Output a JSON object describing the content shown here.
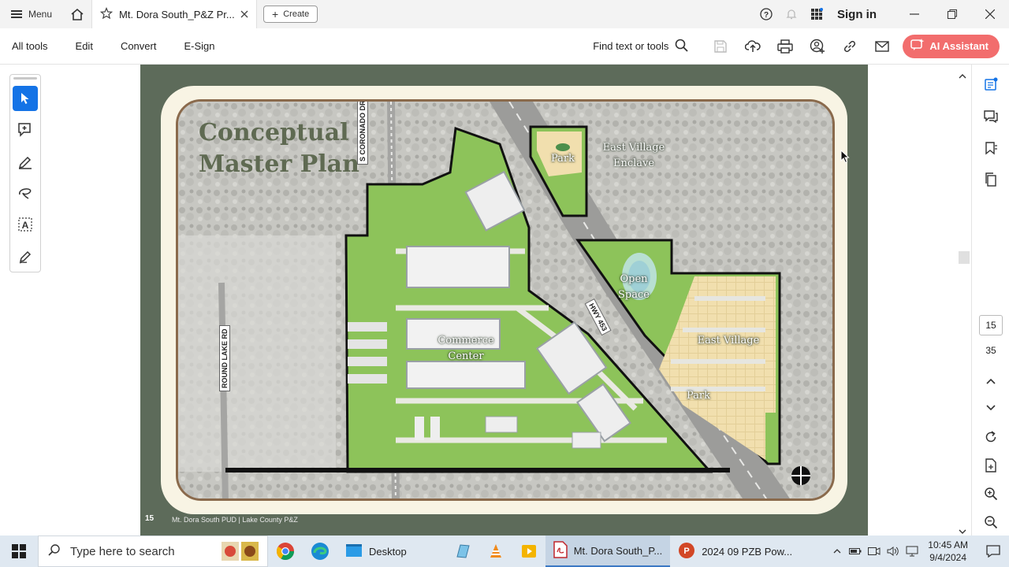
{
  "titlebar": {
    "menu_label": "Menu",
    "tab_title": "Mt. Dora South_P&Z Pr...",
    "create_label": "Create",
    "signin_label": "Sign in"
  },
  "toolbar": {
    "items": [
      "All tools",
      "Edit",
      "Convert",
      "E-Sign"
    ],
    "find_label": "Find text or tools",
    "ai_label": "AI Assistant"
  },
  "document": {
    "title_line1": "Conceptual",
    "title_line2": "Master Plan",
    "labels": {
      "park_top": "Park",
      "east_village_enclave_1": "East Village",
      "east_village_enclave_2": "Enclave",
      "open_space_1": "Open",
      "open_space_2": "Space",
      "commerce_1": "Commerce",
      "commerce_2": "Center",
      "east_village": "East Village",
      "park_bottom": "Park"
    },
    "roads": {
      "coronado": "S CORONADO DR",
      "hwy": "HWY 453",
      "round_lake": "ROUND LAKE RD"
    },
    "page_number": "15",
    "footer": "Mt. Dora South PUD | Lake County P&Z"
  },
  "rightbar": {
    "current_page": "15",
    "total_pages": "35"
  },
  "taskbar": {
    "search_placeholder": "Type here to search",
    "apps": [
      "Desktop",
      "Mt. Dora South_P...",
      "2024 09 PZB Pow..."
    ],
    "time": "10:45 AM",
    "date": "9/4/2024"
  },
  "colors": {
    "accent": "#1473e6",
    "ai_button": "#f26d6d",
    "page_bg": "#5d6b5a",
    "frame_border": "#8a6a4c",
    "title_text": "#5f6a52"
  }
}
